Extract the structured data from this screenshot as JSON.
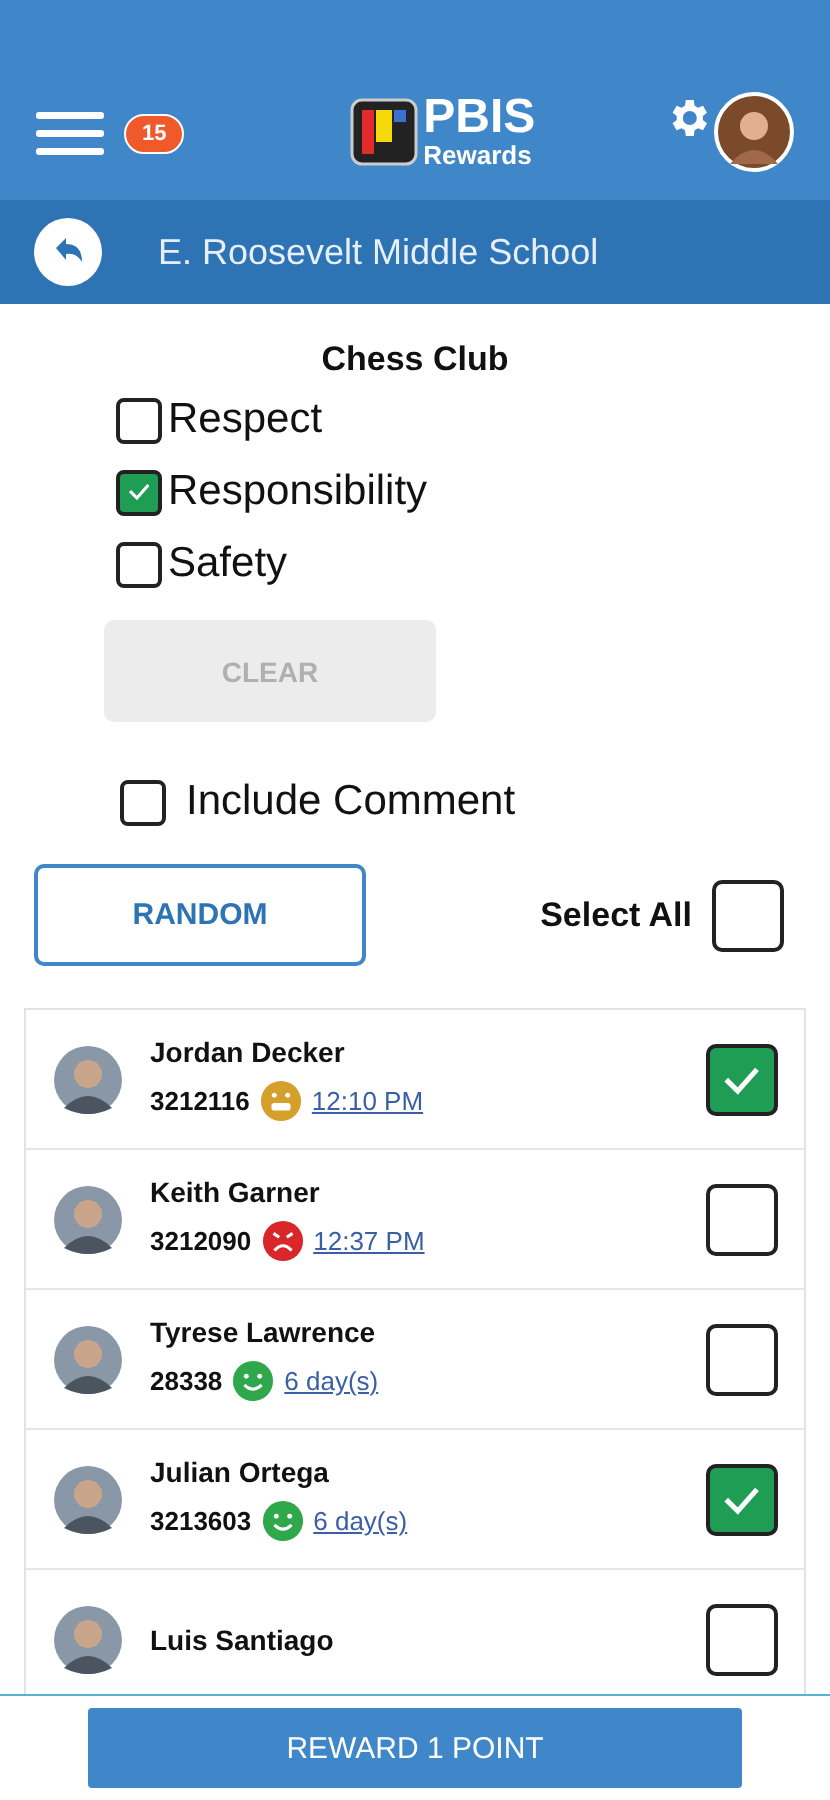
{
  "header": {
    "badge": "15",
    "logo_top": "PBIS",
    "logo_bottom": "Rewards"
  },
  "subbar": {
    "title": "E. Roosevelt Middle School"
  },
  "group": {
    "title": "Chess Club"
  },
  "behaviors": [
    {
      "label": "Respect",
      "checked": false
    },
    {
      "label": "Responsibility",
      "checked": true
    },
    {
      "label": "Safety",
      "checked": false
    }
  ],
  "clear_button": {
    "label": "CLEAR",
    "disabled": true
  },
  "include_comment": {
    "label": "Include Comment",
    "checked": false
  },
  "random_button": {
    "label": "RANDOM"
  },
  "select_all": {
    "label": "Select All",
    "checked": false
  },
  "students": [
    {
      "name": "Jordan Decker",
      "id": "3212116",
      "kind": "meh",
      "color": "#d4a02a",
      "time": "12:10 PM",
      "checked": true
    },
    {
      "name": "Keith Garner",
      "id": "3212090",
      "kind": "angry",
      "color": "#d9262b",
      "time": "12:37 PM",
      "checked": false
    },
    {
      "name": "Tyrese Lawrence",
      "id": "28338",
      "kind": "happy",
      "color": "#2ea84a",
      "time": "6 day(s)",
      "checked": false
    },
    {
      "name": "Julian Ortega",
      "id": "3213603",
      "kind": "happy",
      "color": "#2ea84a",
      "time": "6 day(s)",
      "checked": true
    },
    {
      "name": "Luis Santiago",
      "checked": false
    }
  ],
  "reward_button": {
    "label": "REWARD 1 POINT"
  }
}
